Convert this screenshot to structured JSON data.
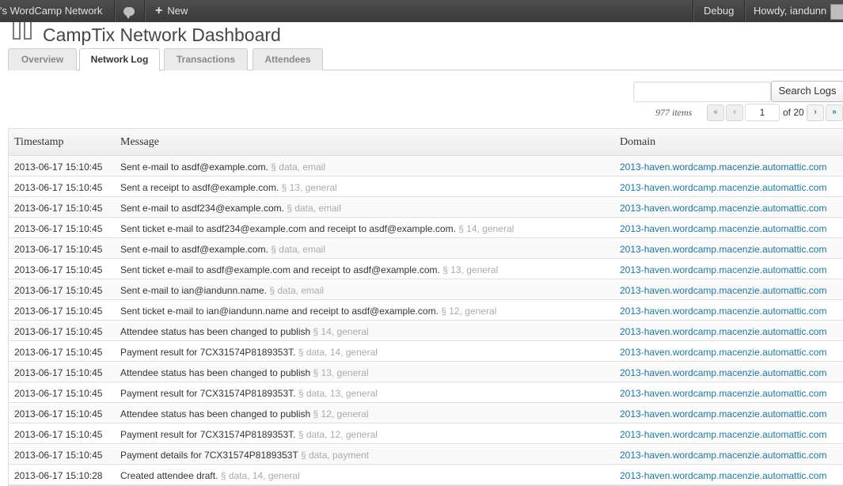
{
  "admin_bar": {
    "site_name": "'s WordCamp Network",
    "new_label": "New",
    "debug_label": "Debug",
    "howdy_label": "Howdy, iandunn"
  },
  "page": {
    "title": "CampTix Network Dashboard"
  },
  "tabs": [
    {
      "label": "Overview",
      "active": false
    },
    {
      "label": "Network Log",
      "active": true
    },
    {
      "label": "Transactions",
      "active": false
    },
    {
      "label": "Attendees",
      "active": false
    }
  ],
  "search": {
    "value": "",
    "button_label": "Search Logs"
  },
  "pagination": {
    "items_count": "977 items",
    "first": "«",
    "prev": "‹",
    "current_page": "1",
    "of_total": "of 20",
    "next": "›",
    "last": "»"
  },
  "table": {
    "headers": {
      "timestamp": "Timestamp",
      "message": "Message",
      "domain": "Domain"
    },
    "rows": [
      {
        "timestamp": "2013-06-17 15:10:45",
        "message": "Sent e-mail to asdf@example.com.",
        "tags": "§ data, email",
        "domain": "2013-haven.wordcamp.macenzie.automattic.com"
      },
      {
        "timestamp": "2013-06-17 15:10:45",
        "message": "Sent a receipt to asdf@example.com.",
        "tags": "§ 13, general",
        "domain": "2013-haven.wordcamp.macenzie.automattic.com"
      },
      {
        "timestamp": "2013-06-17 15:10:45",
        "message": "Sent e-mail to asdf234@example.com.",
        "tags": "§ data, email",
        "domain": "2013-haven.wordcamp.macenzie.automattic.com"
      },
      {
        "timestamp": "2013-06-17 15:10:45",
        "message": "Sent ticket e-mail to asdf234@example.com and receipt to asdf@example.com.",
        "tags": "§ 14, general",
        "domain": "2013-haven.wordcamp.macenzie.automattic.com"
      },
      {
        "timestamp": "2013-06-17 15:10:45",
        "message": "Sent e-mail to asdf@example.com.",
        "tags": "§ data, email",
        "domain": "2013-haven.wordcamp.macenzie.automattic.com"
      },
      {
        "timestamp": "2013-06-17 15:10:45",
        "message": "Sent ticket e-mail to asdf@example.com and receipt to asdf@example.com.",
        "tags": "§ 13, general",
        "domain": "2013-haven.wordcamp.macenzie.automattic.com"
      },
      {
        "timestamp": "2013-06-17 15:10:45",
        "message": "Sent e-mail to ian@iandunn.name.",
        "tags": "§ data, email",
        "domain": "2013-haven.wordcamp.macenzie.automattic.com"
      },
      {
        "timestamp": "2013-06-17 15:10:45",
        "message": "Sent ticket e-mail to ian@iandunn.name and receipt to asdf@example.com.",
        "tags": "§ 12, general",
        "domain": "2013-haven.wordcamp.macenzie.automattic.com"
      },
      {
        "timestamp": "2013-06-17 15:10:45",
        "message": "Attendee status has been changed to publish",
        "tags": "§ 14, general",
        "domain": "2013-haven.wordcamp.macenzie.automattic.com"
      },
      {
        "timestamp": "2013-06-17 15:10:45",
        "message": "Payment result for 7CX31574P8189353T.",
        "tags": "§ data, 14, general",
        "domain": "2013-haven.wordcamp.macenzie.automattic.com"
      },
      {
        "timestamp": "2013-06-17 15:10:45",
        "message": "Attendee status has been changed to publish",
        "tags": "§ 13, general",
        "domain": "2013-haven.wordcamp.macenzie.automattic.com"
      },
      {
        "timestamp": "2013-06-17 15:10:45",
        "message": "Payment result for 7CX31574P8189353T.",
        "tags": "§ data, 13, general",
        "domain": "2013-haven.wordcamp.macenzie.automattic.com"
      },
      {
        "timestamp": "2013-06-17 15:10:45",
        "message": "Attendee status has been changed to publish",
        "tags": "§ 12, general",
        "domain": "2013-haven.wordcamp.macenzie.automattic.com"
      },
      {
        "timestamp": "2013-06-17 15:10:45",
        "message": "Payment result for 7CX31574P8189353T.",
        "tags": "§ data, 12, general",
        "domain": "2013-haven.wordcamp.macenzie.automattic.com"
      },
      {
        "timestamp": "2013-06-17 15:10:45",
        "message": "Payment details for 7CX31574P8189353T",
        "tags": "§ data, payment",
        "domain": "2013-haven.wordcamp.macenzie.automattic.com"
      },
      {
        "timestamp": "2013-06-17 15:10:28",
        "message": "Created attendee draft.",
        "tags": "§ data, 14, general",
        "domain": "2013-haven.wordcamp.macenzie.automattic.com"
      }
    ]
  }
}
